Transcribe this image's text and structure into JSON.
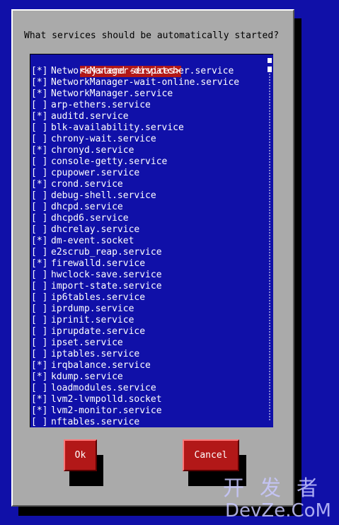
{
  "prompt": "What services should be automatically started?",
  "list_header": "<systemd services>",
  "services": [
    {
      "checked": true,
      "name": "NetworkManager-dispatcher.service"
    },
    {
      "checked": true,
      "name": "NetworkManager-wait-online.service"
    },
    {
      "checked": true,
      "name": "NetworkManager.service"
    },
    {
      "checked": false,
      "name": "arp-ethers.service"
    },
    {
      "checked": true,
      "name": "auditd.service"
    },
    {
      "checked": false,
      "name": "blk-availability.service"
    },
    {
      "checked": false,
      "name": "chrony-wait.service"
    },
    {
      "checked": true,
      "name": "chronyd.service"
    },
    {
      "checked": false,
      "name": "console-getty.service"
    },
    {
      "checked": false,
      "name": "cpupower.service"
    },
    {
      "checked": true,
      "name": "crond.service"
    },
    {
      "checked": false,
      "name": "debug-shell.service"
    },
    {
      "checked": false,
      "name": "dhcpd.service"
    },
    {
      "checked": false,
      "name": "dhcpd6.service"
    },
    {
      "checked": false,
      "name": "dhcrelay.service"
    },
    {
      "checked": true,
      "name": "dm-event.socket"
    },
    {
      "checked": false,
      "name": "e2scrub_reap.service"
    },
    {
      "checked": true,
      "name": "firewalld.service"
    },
    {
      "checked": false,
      "name": "hwclock-save.service"
    },
    {
      "checked": false,
      "name": "import-state.service"
    },
    {
      "checked": false,
      "name": "ip6tables.service"
    },
    {
      "checked": false,
      "name": "iprdump.service"
    },
    {
      "checked": false,
      "name": "iprinit.service"
    },
    {
      "checked": false,
      "name": "iprupdate.service"
    },
    {
      "checked": false,
      "name": "ipset.service"
    },
    {
      "checked": false,
      "name": "iptables.service"
    },
    {
      "checked": true,
      "name": "irqbalance.service"
    },
    {
      "checked": true,
      "name": "kdump.service"
    },
    {
      "checked": false,
      "name": "loadmodules.service"
    },
    {
      "checked": true,
      "name": "lvm2-lvmpolld.socket"
    },
    {
      "checked": true,
      "name": "lvm2-monitor.service"
    },
    {
      "checked": false,
      "name": "nftables.service"
    }
  ],
  "checkbox_on": "[*]",
  "checkbox_off": "[ ]",
  "buttons": {
    "ok": "Ok",
    "cancel": "Cancel"
  },
  "watermark": {
    "cn": "开发者",
    "en": "DevZe.CoM"
  },
  "colors": {
    "background": "#1010a8",
    "dialog": "#aaaaaa",
    "accent": "#b21818"
  }
}
